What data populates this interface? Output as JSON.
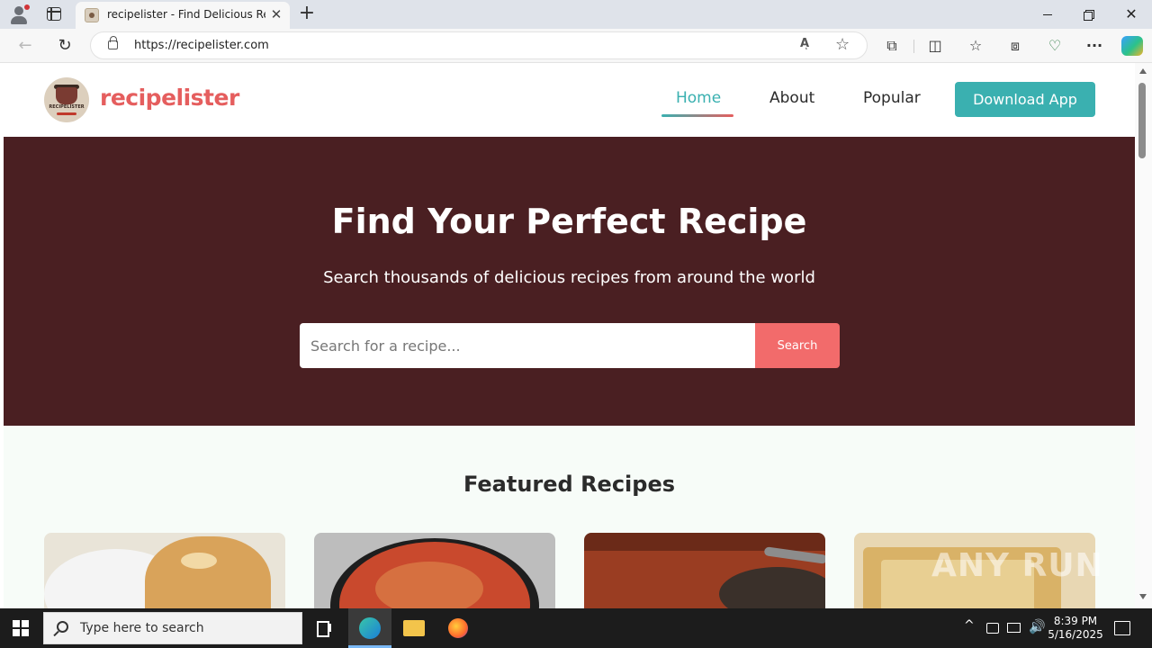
{
  "browser": {
    "tab_title": "recipelister - Find Delicious Recip",
    "tab_close": "✕",
    "new_tab": "+",
    "url": "https://recipelister.com",
    "read_aloud": "Aͅ",
    "window": {
      "close": "✕"
    },
    "nav": {
      "back": "←",
      "reload": "↻"
    },
    "toolbar_glyphs": {
      "extensions": "⧉",
      "split": "◫",
      "favorites": "☆",
      "collections": "⧈",
      "performance": "♡",
      "more": "···",
      "star": "☆"
    }
  },
  "site": {
    "brand": "recipelister",
    "logo_text": "RECIPELISTER",
    "nav": [
      {
        "label": "Home",
        "active": true
      },
      {
        "label": "About"
      },
      {
        "label": "Popular"
      }
    ],
    "download_label": "Download App",
    "hero": {
      "title": "Find Your Perfect Recipe",
      "subtitle": "Search thousands of delicious recipes from around the world",
      "search_placeholder": "Search for a recipe...",
      "search_button": "Search"
    },
    "featured_title": "Featured Recipes",
    "watermark": "ANY RUN"
  },
  "colors": {
    "accent": "#3ab0b0",
    "brand": "#e55e5e",
    "hero_bg": "#4a1f22",
    "search_button": "#f26b6b"
  },
  "taskbar": {
    "search_placeholder": "Type here to search",
    "tray_chevron": "^",
    "tray_volume": "🔊",
    "time": "8:39 PM",
    "date": "5/16/2025"
  }
}
